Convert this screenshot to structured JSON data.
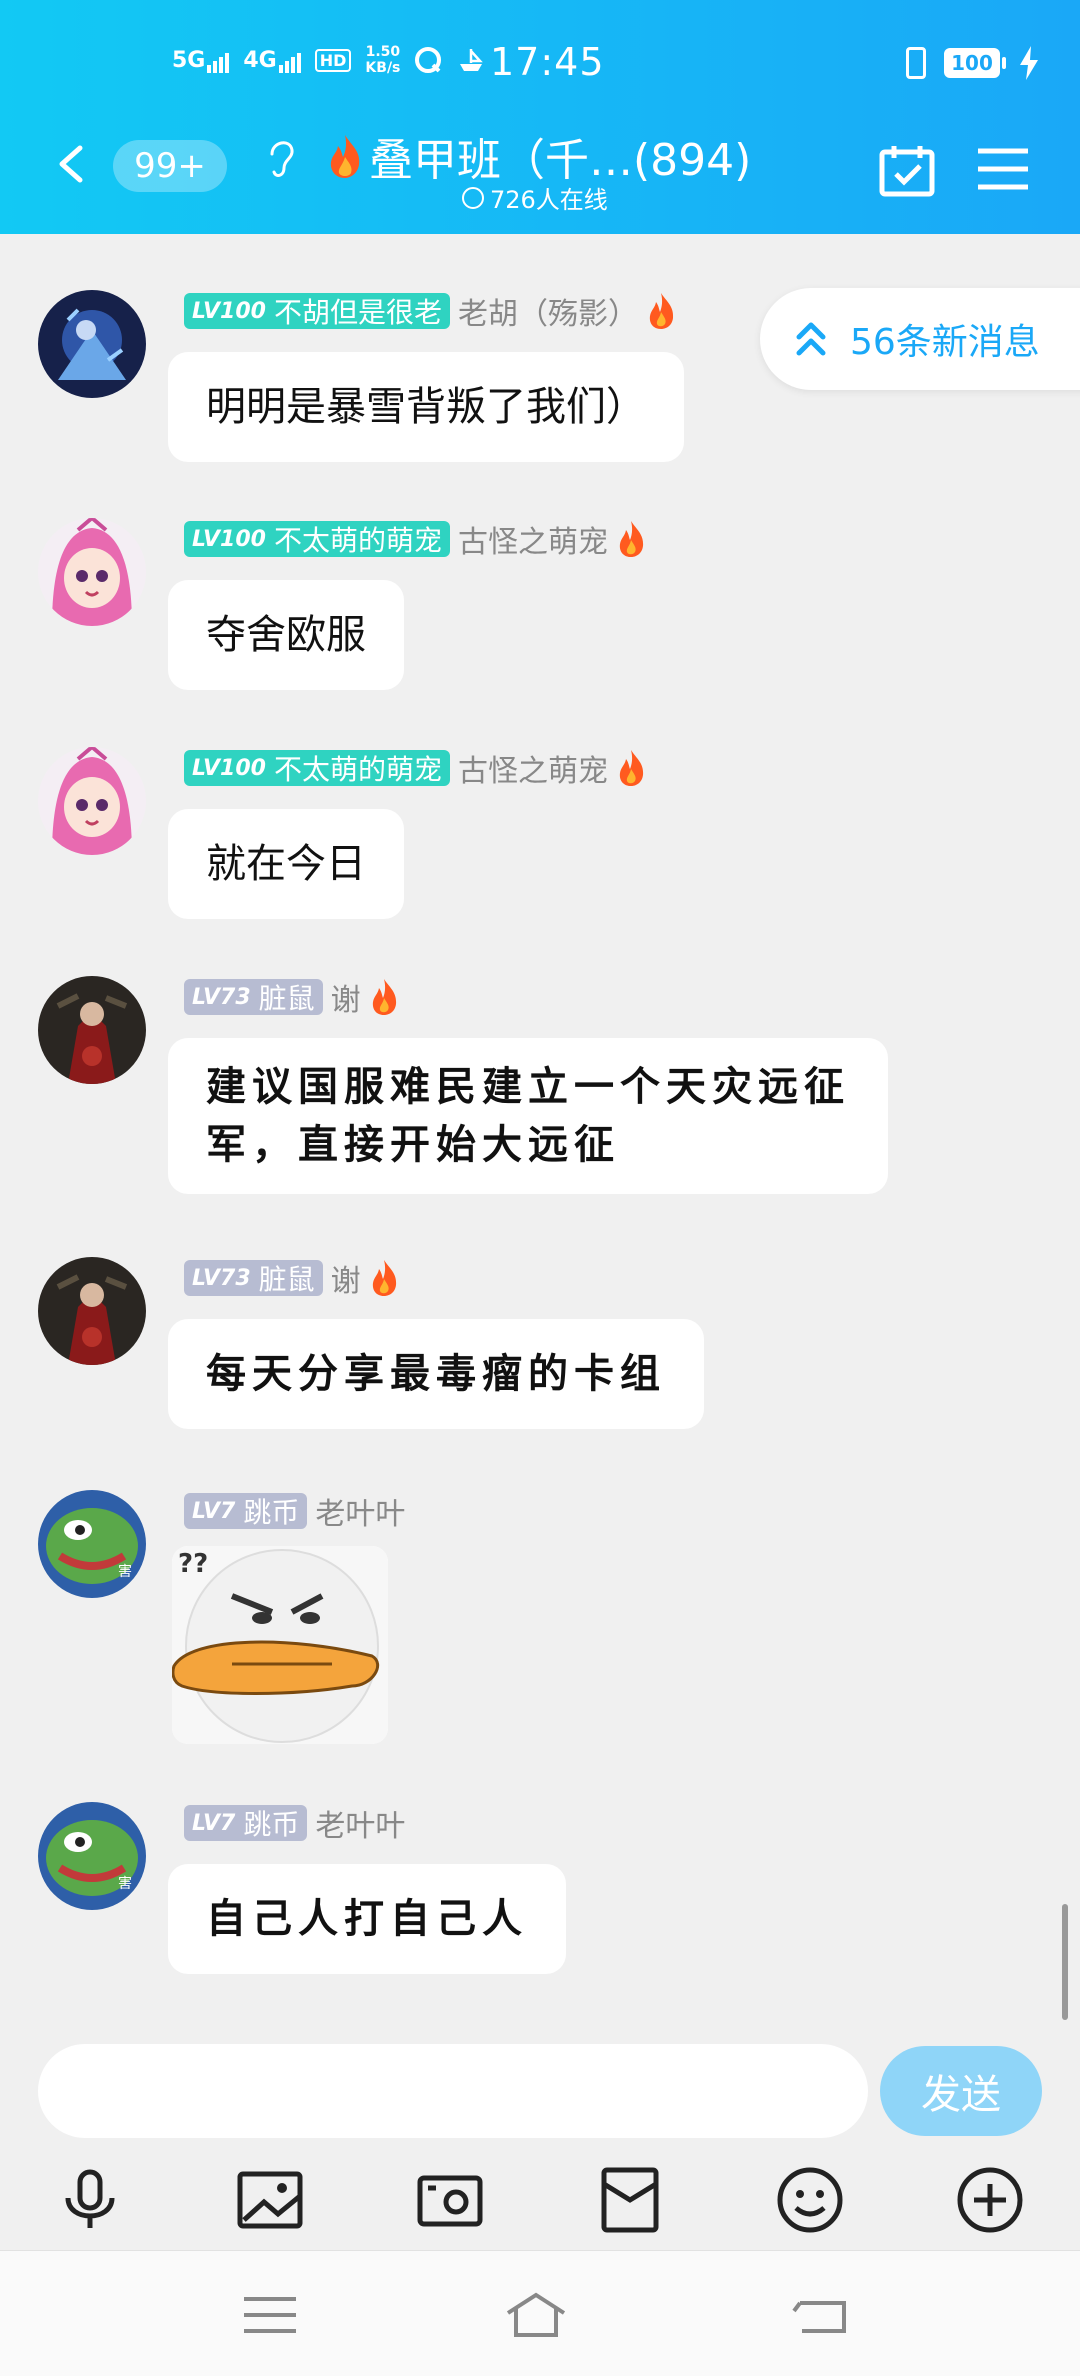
{
  "status_bar": {
    "net1": "5G",
    "net2": "4G",
    "hd_badge": "HD",
    "speed_value": "1.50",
    "speed_unit": "KB/s",
    "time": "17:45",
    "battery": "100"
  },
  "header": {
    "unread_badge": "99+",
    "title": "叠甲班（千…(894)",
    "online": "726人在线",
    "colors": {
      "gradient_start": "#12c9f4",
      "gradient_end": "#1aa8f7"
    }
  },
  "new_messages": "56条新消息",
  "messages": [
    {
      "level": "LV100",
      "title": "不胡但是很老",
      "nick": "老胡（殇影）",
      "text": "明明是暴雪背叛了我们）",
      "style": "normal",
      "badge_color": "#2fd3c1"
    },
    {
      "level": "LV100",
      "title": "不太萌的萌宠",
      "nick": "古怪之萌宠",
      "text": "夺舍欧服",
      "style": "normal",
      "badge_color": "#2fd3c1"
    },
    {
      "level": "LV100",
      "title": "不太萌的萌宠",
      "nick": "古怪之萌宠",
      "text": "就在今日",
      "style": "normal",
      "badge_color": "#2fd3c1"
    },
    {
      "level": "LV73",
      "title": "脏鼠",
      "nick": "谢",
      "text_line1": "建议国服难民建立一个天灾远征",
      "text_line2": "军，直接开始大远征",
      "style": "handwriting",
      "badge_color": "#b7bcd2"
    },
    {
      "level": "LV73",
      "title": "脏鼠",
      "nick": "谢",
      "text": "每天分享最毒瘤的卡组",
      "style": "handwriting",
      "badge_color": "#b7bcd2"
    },
    {
      "level": "LV7",
      "title": "跳币",
      "nick": "老叶叶",
      "sticker_text": "??",
      "style": "sticker",
      "badge_color": "#b7bcd2"
    },
    {
      "level": "LV7",
      "title": "跳币",
      "nick": "老叶叶",
      "text": "自己人打自己人",
      "style": "handwriting",
      "badge_color": "#b7bcd2"
    }
  ],
  "avatar_tag": "害",
  "input": {
    "placeholder": "",
    "send_label": "发送"
  },
  "toolbar_icons": [
    "microphone-icon",
    "image-icon",
    "camera-icon",
    "red-packet-icon",
    "emoji-icon",
    "plus-icon"
  ],
  "system_nav": [
    "menu-icon",
    "home-icon",
    "back-icon"
  ]
}
